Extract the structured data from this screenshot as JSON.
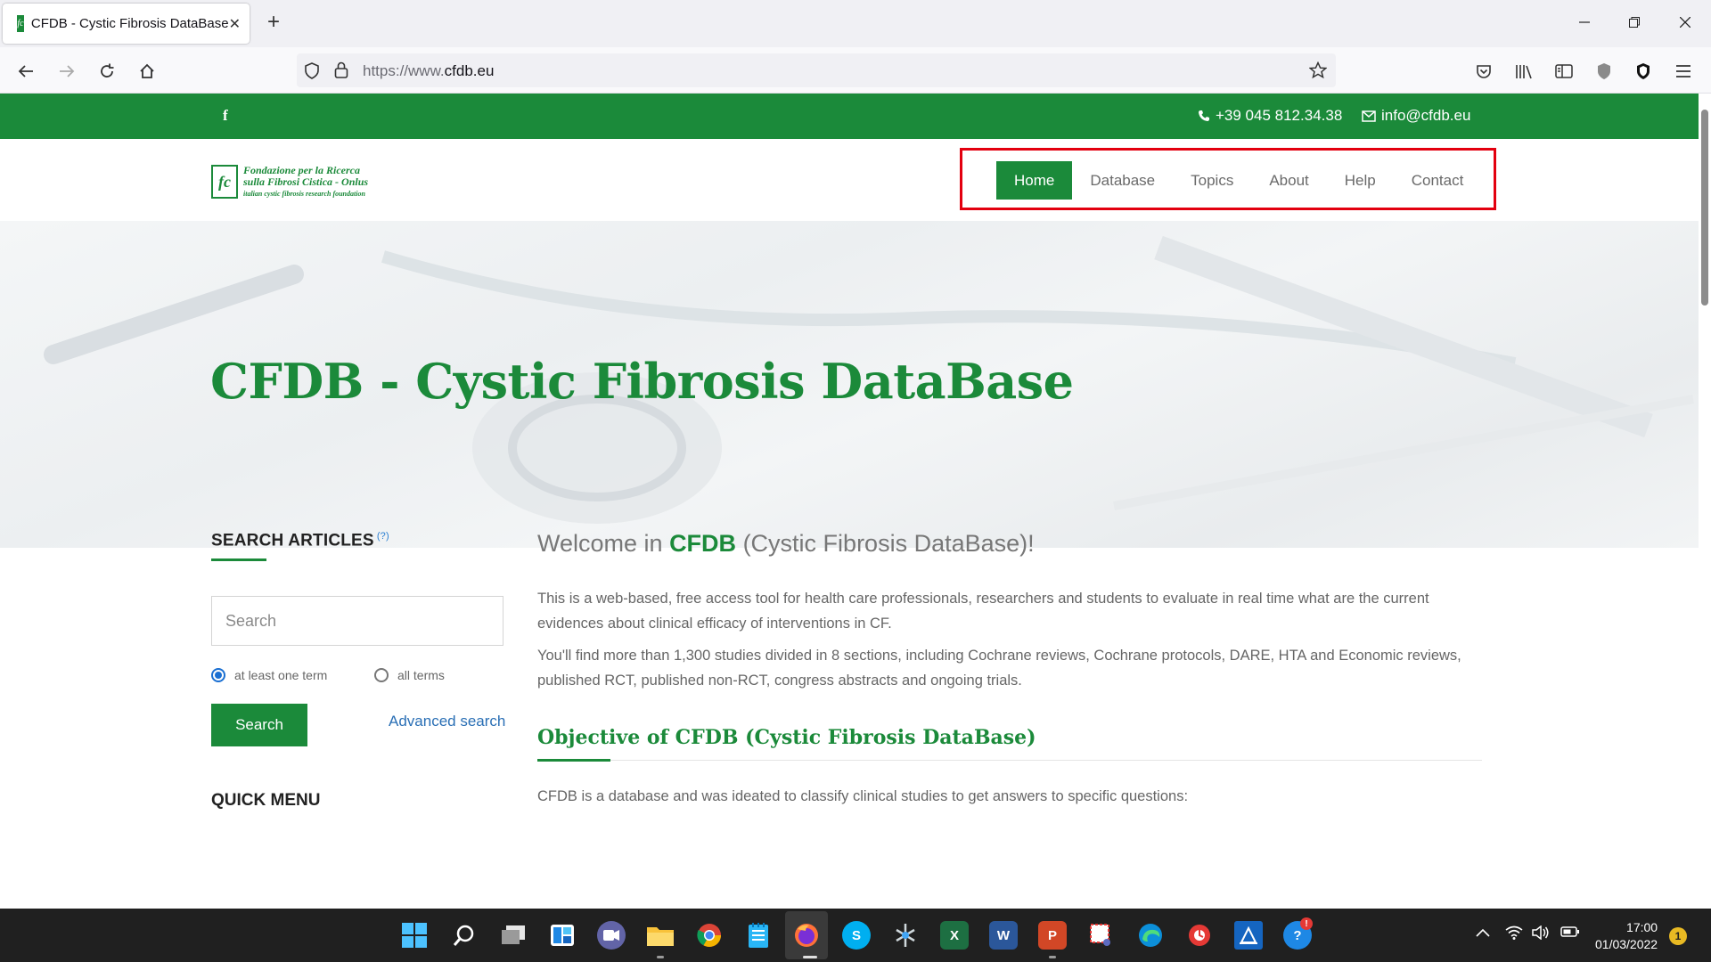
{
  "browser": {
    "tab_title": "CFDB - Cystic Fibrosis DataBase",
    "tab_favicon_text": "fc",
    "url_prefix": "https://www.",
    "url_domain": "cfdb.eu",
    "icons": [
      "back-icon",
      "forward-icon",
      "reload-icon",
      "home-icon",
      "shield-icon",
      "lock-icon",
      "star-icon",
      "pocket-icon",
      "library-icon",
      "sidebar-icon",
      "extension-icon",
      "ublock-icon",
      "menu-icon"
    ]
  },
  "site": {
    "topbar": {
      "facebook": "f",
      "phone": "+39 045 812.34.38",
      "email": "info@cfdb.eu"
    },
    "logo": {
      "mark": "fc",
      "line1": "Fondazione per la Ricerca",
      "line2": "sulla Fibrosi Cistica - Onlus",
      "line3": "italian cystic fibrosis research foundation"
    },
    "menu": [
      {
        "label": "Home",
        "active": true
      },
      {
        "label": "Database"
      },
      {
        "label": "Topics"
      },
      {
        "label": "About"
      },
      {
        "label": "Help"
      },
      {
        "label": "Contact"
      }
    ],
    "hero_title": "CFDB - Cystic Fibrosis DataBase",
    "sidebar": {
      "title": "SEARCH ARTICLES",
      "help_mark": "(?)",
      "search_placeholder": "Search",
      "radio_at_least_one": "at least one term",
      "radio_all_terms": "all terms",
      "search_button": "Search",
      "advanced_search": "Advanced search",
      "quick_menu": "QUICK MENU"
    },
    "content": {
      "welcome_prefix": "Welcome in ",
      "welcome_brand": "CFDB",
      "welcome_suffix": " (Cystic Fibrosis DataBase)!",
      "para1": "This is a web-based, free access tool for health care professionals, researchers and students to evaluate in real time what are the current evidences about clinical efficacy of interventions in CF.",
      "para2": "You'll find more than 1,300 studies divided in 8 sections, including Cochrane reviews, Cochrane protocols, DARE, HTA and Economic reviews, published RCT, published non-RCT, congress abstracts and ongoing trials.",
      "objective_title": "Objective of CFDB (Cystic Fibrosis DataBase)",
      "para3": "CFDB is a database and was ideated to classify clinical studies to get answers to specific questions:"
    }
  },
  "taskbar": {
    "time": "17:00",
    "date": "01/03/2022",
    "notification_count": "1",
    "apps": [
      "windows-start",
      "search",
      "task-view",
      "widgets",
      "teams-chat",
      "file-explorer",
      "chrome",
      "notepad",
      "firefox",
      "skype",
      "network-app",
      "excel",
      "word",
      "powerpoint",
      "snipping-tool",
      "edge",
      "recovery-app",
      "azure-app",
      "help-app"
    ]
  },
  "colors": {
    "brand_green": "#1b8a3a",
    "highlight_red": "#e3000f",
    "link_blue": "#2a6fb5"
  }
}
